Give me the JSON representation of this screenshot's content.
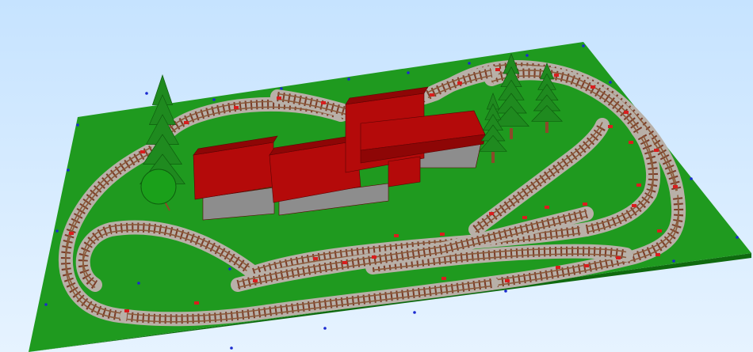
{
  "viewport": {
    "background_top": "#c6e3ff",
    "background_bottom": "#e6f3ff"
  },
  "colors": {
    "baseboard": "#1f9a1f",
    "baseboard_edge": "#0f6a0f",
    "track_ballast": "#b8b0a8",
    "track_rail": "#8a5a3a",
    "track_tie": "#7a3c28",
    "track_marker": "#d81e1e",
    "building_roof": "#b40a0a",
    "building_roof_dark": "#8e0606",
    "building_wall": "#8d8d8d",
    "tree_conifer": "#1f8a1f",
    "tree_deciduous": "#1aa01a",
    "trunk": "#8a4a2a",
    "grid_dot": "#1a2ad0"
  },
  "objects": {
    "baseboard": "green-baseboard",
    "track": "track-layout",
    "building": "station-building",
    "trees": [
      "conifer-tree",
      "conifer-tree",
      "conifer-tree",
      "conifer-tree",
      "deciduous-tree"
    ]
  }
}
